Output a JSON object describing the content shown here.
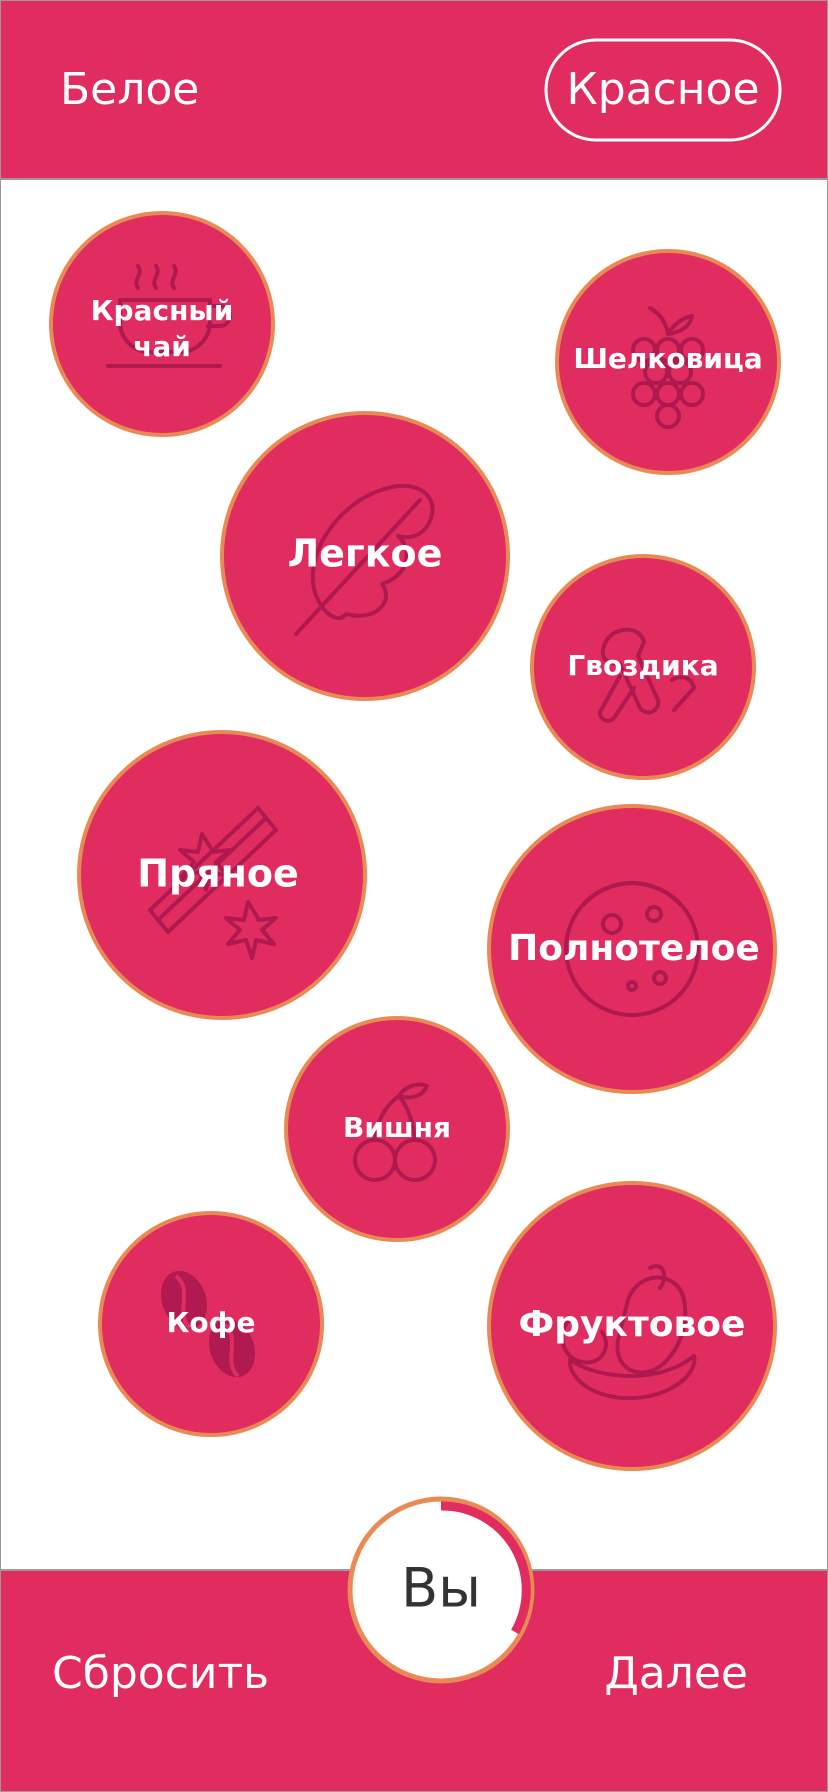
{
  "header": {
    "tab_white": "Белое",
    "tab_red": "Красное",
    "selected_tab": "Красное"
  },
  "bubbles": [
    {
      "key": "red_tea",
      "line1": "Красный",
      "line2": "чай",
      "icon": "tea-cup-icon"
    },
    {
      "key": "mulberry",
      "line1": "Шелковица",
      "line2": "",
      "icon": "grapes-icon"
    },
    {
      "key": "light",
      "line1": "Легкое",
      "line2": "",
      "icon": "feather-icon"
    },
    {
      "key": "clove",
      "line1": "Гвоздика",
      "line2": "",
      "icon": "clove-icon"
    },
    {
      "key": "spicy",
      "line1": "Пряное",
      "line2": "",
      "icon": "cinnamon-star-anise-icon"
    },
    {
      "key": "full_bodied",
      "line1": "Полнотелое",
      "line2": "",
      "icon": "cheese-wheel-icon"
    },
    {
      "key": "cherry",
      "line1": "Вишня",
      "line2": "",
      "icon": "cherry-icon"
    },
    {
      "key": "coffee",
      "line1": "Кофе",
      "line2": "",
      "icon": "coffee-bean-icon"
    },
    {
      "key": "fruity",
      "line1": "Фруктовое",
      "line2": "",
      "icon": "fruit-icon"
    }
  ],
  "footer": {
    "reset_label": "Сбросить",
    "next_label": "Далее",
    "you_label": "Вы"
  },
  "colors": {
    "accent": "#e12c5f",
    "bubble_border": "#e98a55",
    "icon": "#a9184f"
  }
}
